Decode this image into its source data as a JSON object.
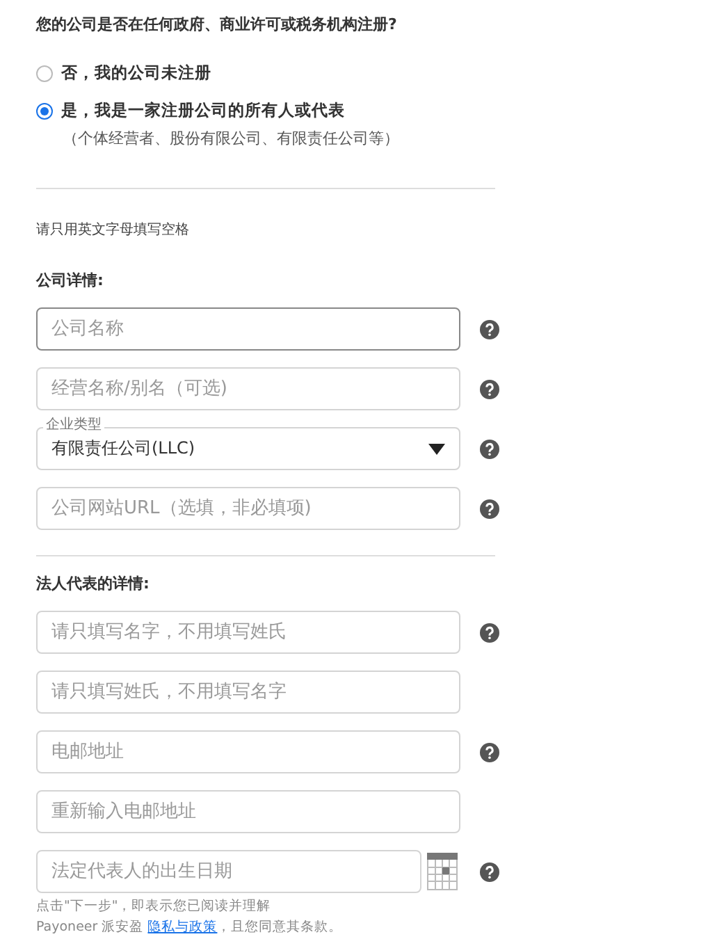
{
  "question": "您的公司是否在任何政府、商业许可或税务机构注册?",
  "options": [
    {
      "label": "否，我的公司未注册",
      "selected": false
    },
    {
      "label": "是，我是一家注册公司的所有人或代表",
      "note": "（个体经营者、股份有限公司、有限责任公司等）",
      "selected": true
    }
  ],
  "hint": "请只用英文字母填写空格",
  "sections": [
    {
      "heading": "公司详情:",
      "fields": [
        {
          "kind": "input",
          "placeholder": "公司名称",
          "focused": true,
          "help": true
        },
        {
          "kind": "input",
          "placeholder": "经营名称/别名（可选)",
          "focused": false,
          "help": true
        },
        {
          "kind": "select",
          "label": "企业类型",
          "value": "有限责任公司(LLC)",
          "focused": false,
          "help": true
        },
        {
          "kind": "input",
          "placeholder": "公司网站URL（选填，非必填项)",
          "focused": false,
          "help": true
        }
      ]
    },
    {
      "heading": "法人代表的详情:",
      "fields": [
        {
          "kind": "input",
          "placeholder": "请只填写名字，不用填写姓氏",
          "focused": false,
          "help": true
        },
        {
          "kind": "input",
          "placeholder": "请只填写姓氏，不用填写名字",
          "focused": false,
          "help": false
        },
        {
          "kind": "input",
          "placeholder": "电邮地址",
          "focused": false,
          "help": true
        },
        {
          "kind": "input",
          "placeholder": "重新输入电邮地址",
          "focused": false,
          "help": false
        },
        {
          "kind": "date",
          "placeholder": "法定代表人的出生日期",
          "focused": false,
          "help": true
        }
      ]
    }
  ],
  "footer": {
    "line1": "点击\"下一步\"，即表示您已阅读并理解",
    "prefix": "Payoneer 派安盈 ",
    "link": "隐私与政策",
    "suffix": "，且您同意其条款。"
  }
}
